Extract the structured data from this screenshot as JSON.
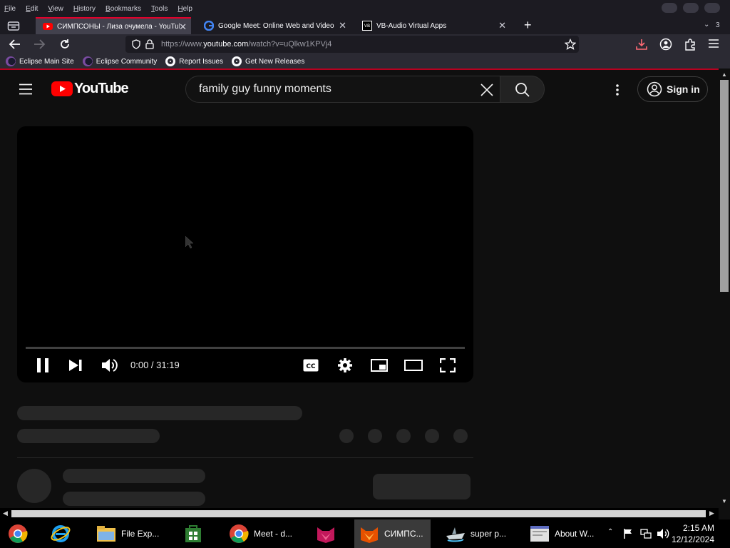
{
  "menubar": {
    "items": [
      "File",
      "Edit",
      "View",
      "History",
      "Bookmarks",
      "Tools",
      "Help"
    ]
  },
  "tabs": [
    {
      "title": "СИМПСОНЫ - Лиза очумела - YouTul",
      "active": true,
      "icon": "youtube-icon"
    },
    {
      "title": "Google Meet: Online Web and Video",
      "active": false,
      "icon": "google-icon"
    },
    {
      "title": "VB-Audio Virtual Apps",
      "active": false,
      "icon": "vb-audio-icon"
    }
  ],
  "tab_overflow_count": "3",
  "url": {
    "prefix": "https://www.",
    "domain": "youtube.com",
    "path": "/watch?v=uQlkw1KPVj4"
  },
  "bookmarks": [
    "Eclipse Main Site",
    "Eclipse Community",
    "Report Issues",
    "Get New Releases"
  ],
  "youtube": {
    "logo_text": "YouTube",
    "search_query": "family guy funny moments",
    "signin_label": "Sign in"
  },
  "player": {
    "time": "0:00 / 31:19",
    "progress": 0
  },
  "taskbar": {
    "items": [
      {
        "label": "",
        "icon": "chrome-icon"
      },
      {
        "label": "",
        "icon": "internet-explorer-icon"
      },
      {
        "label": "File Exp...",
        "icon": "file-explorer-icon"
      },
      {
        "label": "",
        "icon": "store-icon"
      },
      {
        "label": "Meet - d...",
        "icon": "chrome-icon"
      },
      {
        "label": "",
        "icon": "cat-icon"
      },
      {
        "label": "СИМПС...",
        "icon": "firefox-cat-icon"
      },
      {
        "label": "super p...",
        "icon": "ship-icon"
      },
      {
        "label": "About W...",
        "icon": "window-icon"
      }
    ],
    "time": "2:15 AM",
    "date": "12/12/2024"
  },
  "colors": {
    "accent_red": "#ff0000",
    "tab_indicator": "#e2002b",
    "background": "#0f0f0f"
  }
}
